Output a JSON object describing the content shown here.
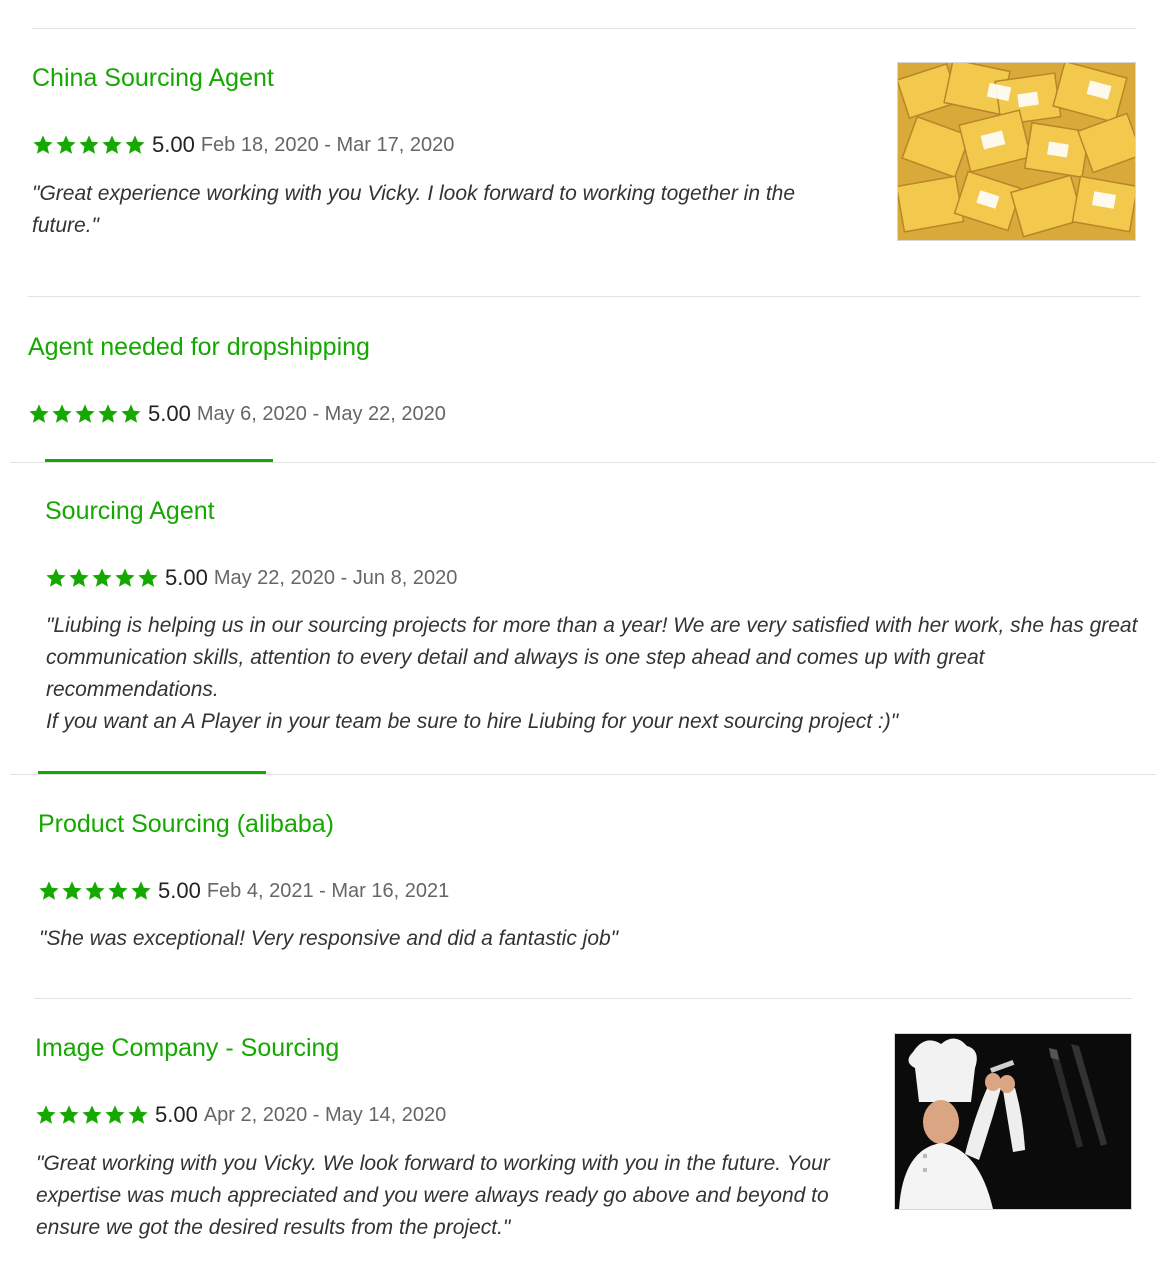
{
  "reviews": [
    {
      "title": "China Sourcing Agent",
      "rating": "5.00",
      "dates": "Feb 18, 2020 - Mar 17, 2020",
      "quote": "\"Great experience working with you Vicky. I look forward to working together in the future.\""
    },
    {
      "title": "Agent needed for dropshipping",
      "rating": "5.00",
      "dates": "May 6, 2020 - May 22, 2020"
    },
    {
      "title": "Sourcing Agent",
      "rating": "5.00",
      "dates": "May 22, 2020 - Jun 8, 2020",
      "quote": "\"Liubing is helping us in our sourcing projects for more than a year! We are very satisfied with her work, she has great communication skills, attention to every detail and always is one step ahead and comes up with great recommendations.",
      "quote_line2": "If you want an A Player in your team be sure to hire Liubing for your next sourcing project :)\""
    },
    {
      "title": "Product Sourcing (alibaba)",
      "rating": "5.00",
      "dates": "Feb 4, 2021 - Mar 16, 2021",
      "quote": "\"She was exceptional! Very responsive and did a fantastic job\""
    },
    {
      "title": "Image Company - Sourcing",
      "rating": "5.00",
      "dates": "Apr 2, 2020 - May 14, 2020",
      "quote": "\"Great working with you Vicky. We look forward to working with you in the future. Your expertise was much appreciated and you were always ready go above and beyond to ensure we got the desired results from the project.\""
    }
  ],
  "colors": {
    "accent": "#14a800",
    "divider": "#e2e2e2"
  },
  "star_icon": "star-icon",
  "stars_filled": 5
}
